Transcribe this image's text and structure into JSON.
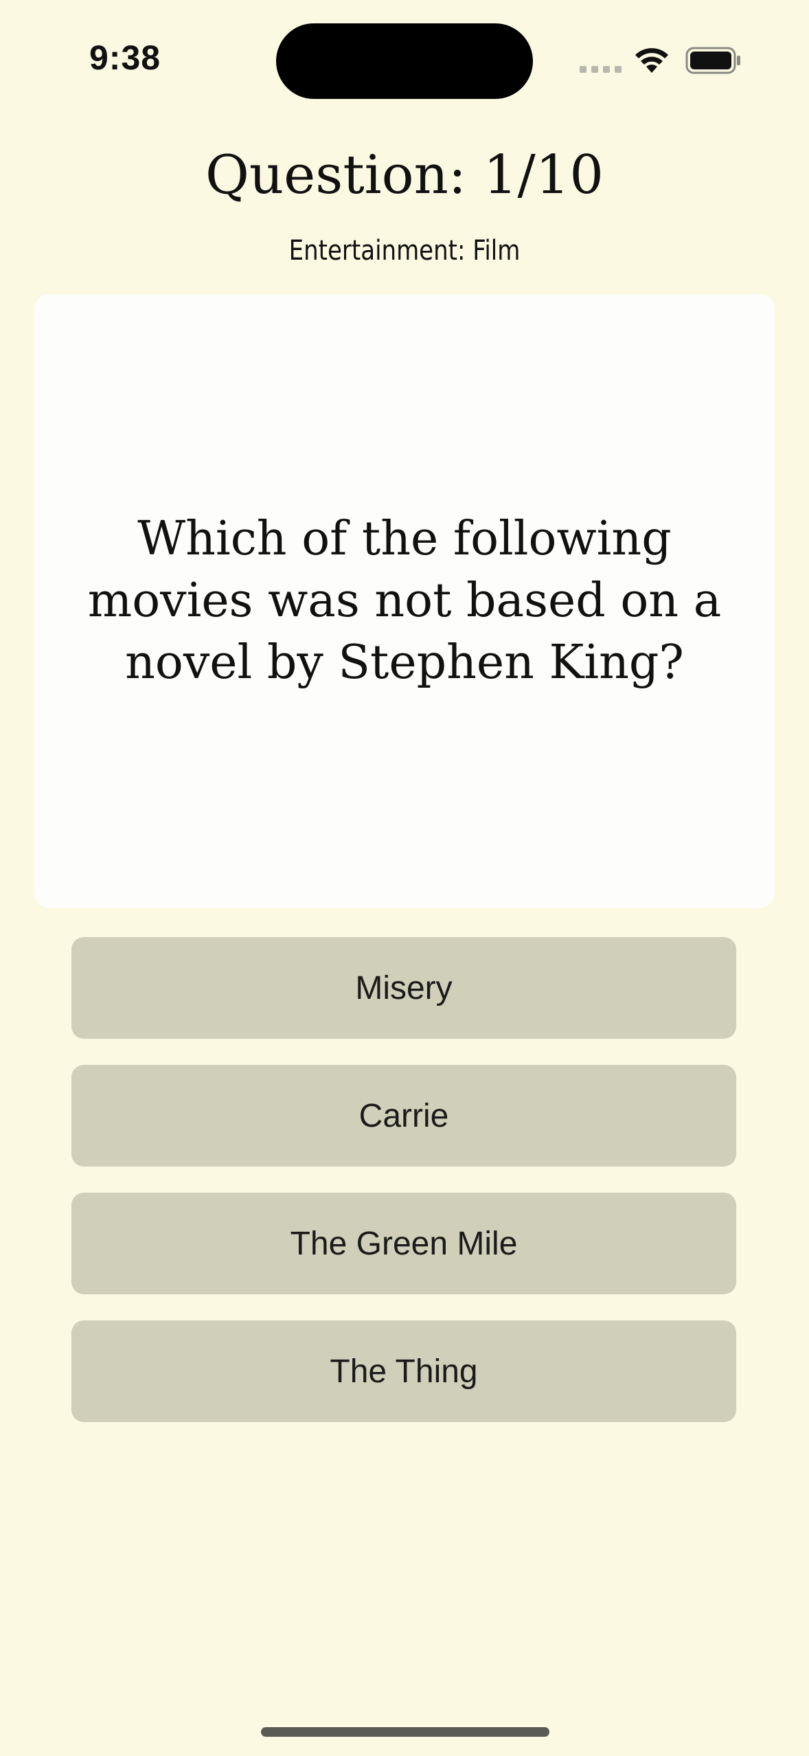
{
  "status_bar": {
    "time": "9:38"
  },
  "header": {
    "title": "Question: 1/10",
    "category": "Entertainment: Film"
  },
  "question": {
    "text": "Which of the following movies was not based on a novel by Stephen King?"
  },
  "answers": [
    {
      "label": "Misery"
    },
    {
      "label": "Carrie"
    },
    {
      "label": "The Green Mile"
    },
    {
      "label": "The Thing"
    }
  ],
  "colors": {
    "background": "#fbf9e2",
    "card": "#fdfdfc",
    "answer_button": "#d0cfb9",
    "text": "#111111"
  },
  "icons": [
    "signal-icon",
    "wifi-icon",
    "battery-icon"
  ]
}
